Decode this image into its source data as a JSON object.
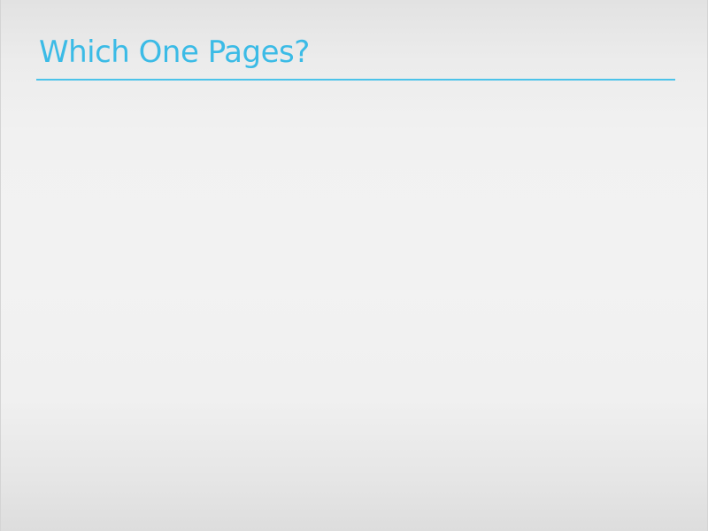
{
  "slide": {
    "title": "Which One Pages?"
  },
  "colors": {
    "accent": "#3bbbe6",
    "background": "#f2f2f2"
  }
}
